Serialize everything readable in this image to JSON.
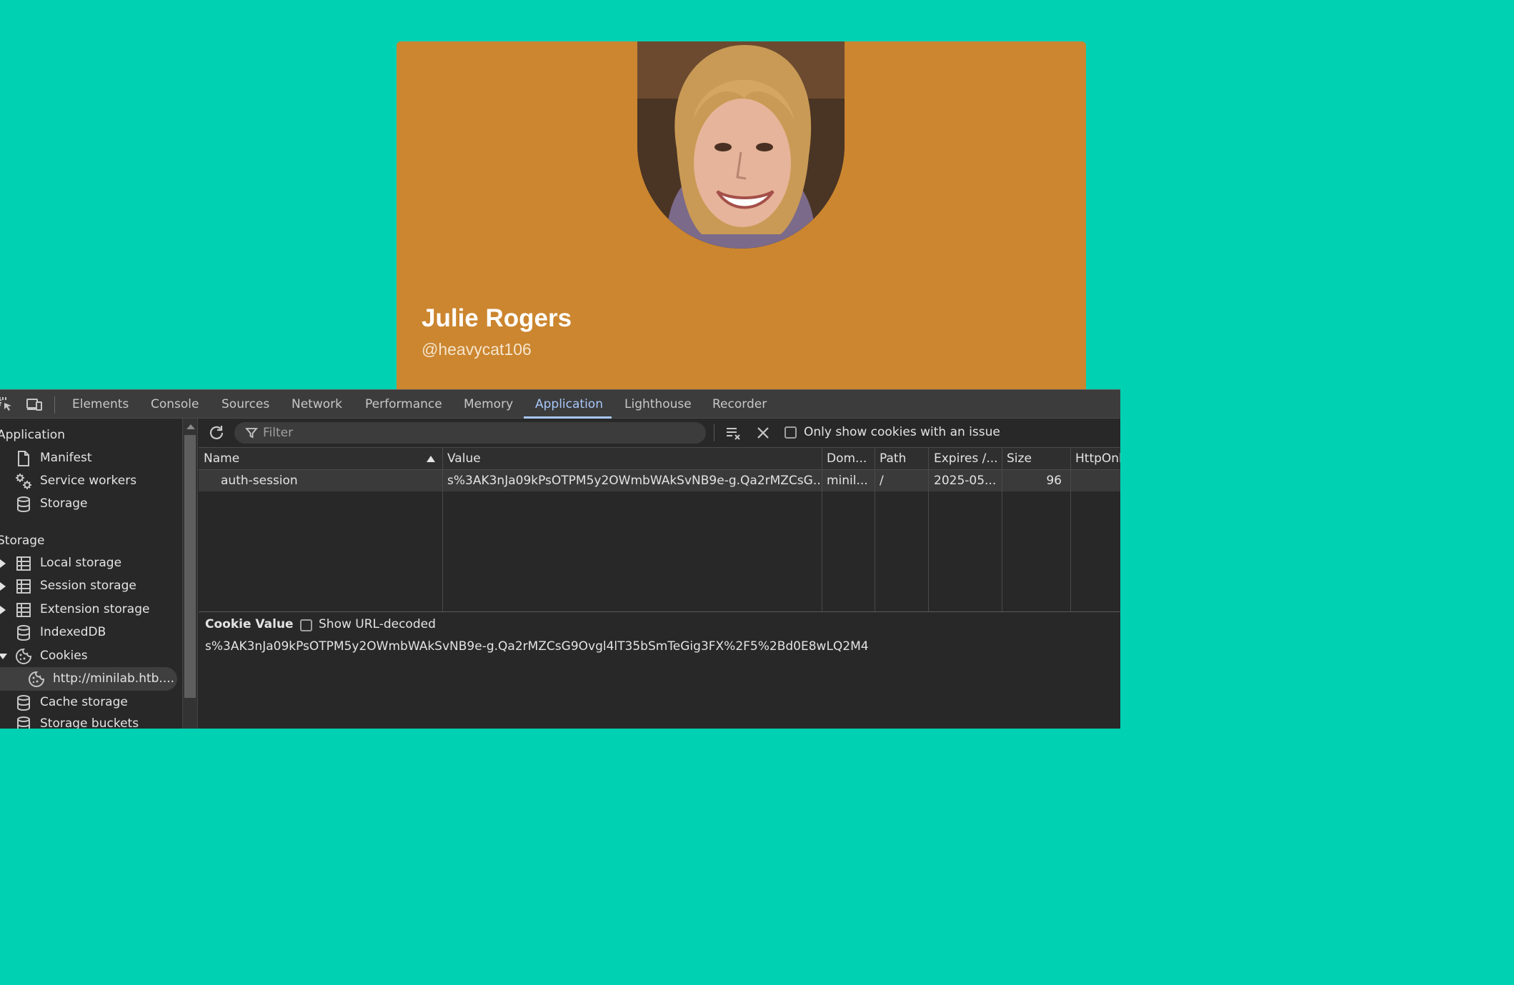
{
  "profile": {
    "name": "Julie Rogers",
    "handle": "@heavycat106",
    "card_color": "#cb862f",
    "background_color": "#00d1b2"
  },
  "devtools": {
    "toolbar_icons": [
      "inspect-element-icon",
      "device-toolbar-icon"
    ],
    "tabs": [
      {
        "label": "Elements",
        "active": false
      },
      {
        "label": "Console",
        "active": false
      },
      {
        "label": "Sources",
        "active": false
      },
      {
        "label": "Network",
        "active": false
      },
      {
        "label": "Performance",
        "active": false
      },
      {
        "label": "Memory",
        "active": false
      },
      {
        "label": "Application",
        "active": true
      },
      {
        "label": "Lighthouse",
        "active": false
      },
      {
        "label": "Recorder",
        "active": false
      }
    ],
    "accent_color": "#a8c7fa",
    "sidebar": {
      "application_header": "Application",
      "application_items": [
        {
          "label": "Manifest",
          "icon": "file-icon"
        },
        {
          "label": "Service workers",
          "icon": "gears-icon"
        },
        {
          "label": "Storage",
          "icon": "database-icon"
        }
      ],
      "storage_header": "Storage",
      "storage_items": [
        {
          "label": "Local storage",
          "icon": "table-icon",
          "expandable": true
        },
        {
          "label": "Session storage",
          "icon": "table-icon",
          "expandable": true
        },
        {
          "label": "Extension storage",
          "icon": "table-icon",
          "expandable": true
        },
        {
          "label": "IndexedDB",
          "icon": "database-icon",
          "expandable": false
        },
        {
          "label": "Cookies",
          "icon": "cookie-icon",
          "expanded": true
        },
        {
          "label": "http://minilab.htb....",
          "icon": "cookie-icon",
          "selected": true
        },
        {
          "label": "Cache storage",
          "icon": "database-icon",
          "expandable": false
        },
        {
          "label": "Storage buckets",
          "icon": "database-icon",
          "expandable": false
        }
      ]
    },
    "cookies_toolbar": {
      "filter_placeholder": "Filter",
      "issue_checkbox_label": "Only show cookies with an issue",
      "issue_checkbox_checked": false
    },
    "cookie_table": {
      "columns": [
        "Name",
        "Value",
        "Dom...",
        "Path",
        "Expires /...",
        "Size",
        "HttpOnl"
      ],
      "sorted_column": "Name",
      "sort_direction": "ascending",
      "rows": [
        {
          "name": "auth-session",
          "value": "s%3AK3nJa09kPsOTPM5y2OWmbWAkSvNB9e-g.Qa2rMZCsG...",
          "domain": "minil...",
          "path": "/",
          "expires": "2025-05...",
          "size": "96",
          "httponly": ""
        }
      ]
    },
    "cookie_value_pane": {
      "title": "Cookie Value",
      "decode_label": "Show URL-decoded",
      "decode_checked": false,
      "value": "s%3AK3nJa09kPsOTPM5y2OWmbWAkSvNB9e-g.Qa2rMZCsG9Ovgl4lT35bSmTeGig3FX%2F5%2Bd0E8wLQ2M4"
    }
  }
}
